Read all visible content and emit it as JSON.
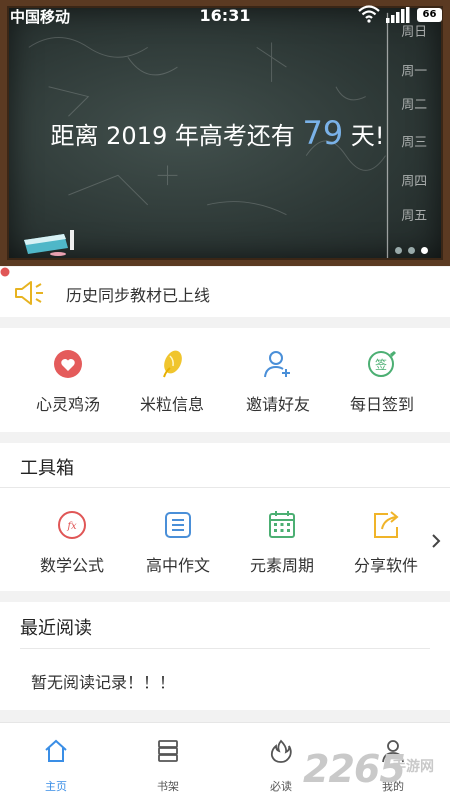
{
  "status": {
    "carrier": "中国移动",
    "time": "16:31",
    "battery": "66"
  },
  "banner": {
    "headline_prefix": "距离 2019 年高考还有 ",
    "days": "79",
    "headline_suffix": " 天!"
  },
  "notice": {
    "text": "历史同步教材已上线"
  },
  "quick_actions": [
    {
      "label": "心灵鸡汤",
      "icon": "heart-icon",
      "color": "#e45b5b"
    },
    {
      "label": "米粒信息",
      "icon": "rice-icon",
      "color": "#f0c52e"
    },
    {
      "label": "邀请好友",
      "icon": "invite-friend-icon",
      "color": "#4a8fd8"
    },
    {
      "label": "每日签到",
      "icon": "checkin-icon",
      "color": "#4caf73"
    }
  ],
  "toolbox": {
    "title": "工具箱",
    "items": [
      {
        "label": "数学公式",
        "icon": "formula-icon",
        "color": "#e05656"
      },
      {
        "label": "高中作文",
        "icon": "essay-icon",
        "color": "#4a8fd8"
      },
      {
        "label": "元素周期",
        "icon": "calendar-icon",
        "color": "#4caf73"
      },
      {
        "label": "分享软件",
        "icon": "share-icon",
        "color": "#f0b429"
      }
    ]
  },
  "recent": {
    "title": "最近阅读",
    "empty_text": "暂无阅读记录！！！"
  },
  "nav": [
    {
      "label": "主页",
      "icon": "home-icon",
      "active": true
    },
    {
      "label": "书架",
      "icon": "bookshelf-icon",
      "active": false
    },
    {
      "label": "必读",
      "icon": "flame-icon",
      "active": false
    },
    {
      "label": "我的",
      "icon": "profile-icon",
      "active": false
    }
  ],
  "watermark": {
    "main": "2265",
    "sub": "手游网"
  },
  "colors": {
    "accent": "#3a8ee6",
    "notice_dot": "#e05656"
  }
}
